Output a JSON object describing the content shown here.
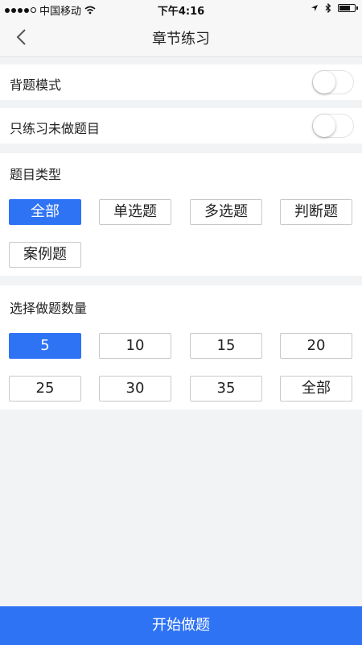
{
  "status_bar": {
    "carrier": "中国移动",
    "time": "下午4:16"
  },
  "nav": {
    "title": "章节练习"
  },
  "settings": [
    {
      "label": "背题模式",
      "enabled": false
    },
    {
      "label": "只练习未做题目",
      "enabled": false
    }
  ],
  "question_type": {
    "title": "题目类型",
    "options": [
      "全部",
      "单选题",
      "多选题",
      "判断题",
      "案例题"
    ],
    "selected": "全部"
  },
  "question_count": {
    "title": "选择做题数量",
    "options": [
      "5",
      "10",
      "15",
      "20",
      "25",
      "30",
      "35",
      "全部"
    ],
    "selected": "5"
  },
  "start_button": {
    "label": "开始做题"
  },
  "colors": {
    "accent": "#2f73f5",
    "background": "#f2f3f5"
  }
}
